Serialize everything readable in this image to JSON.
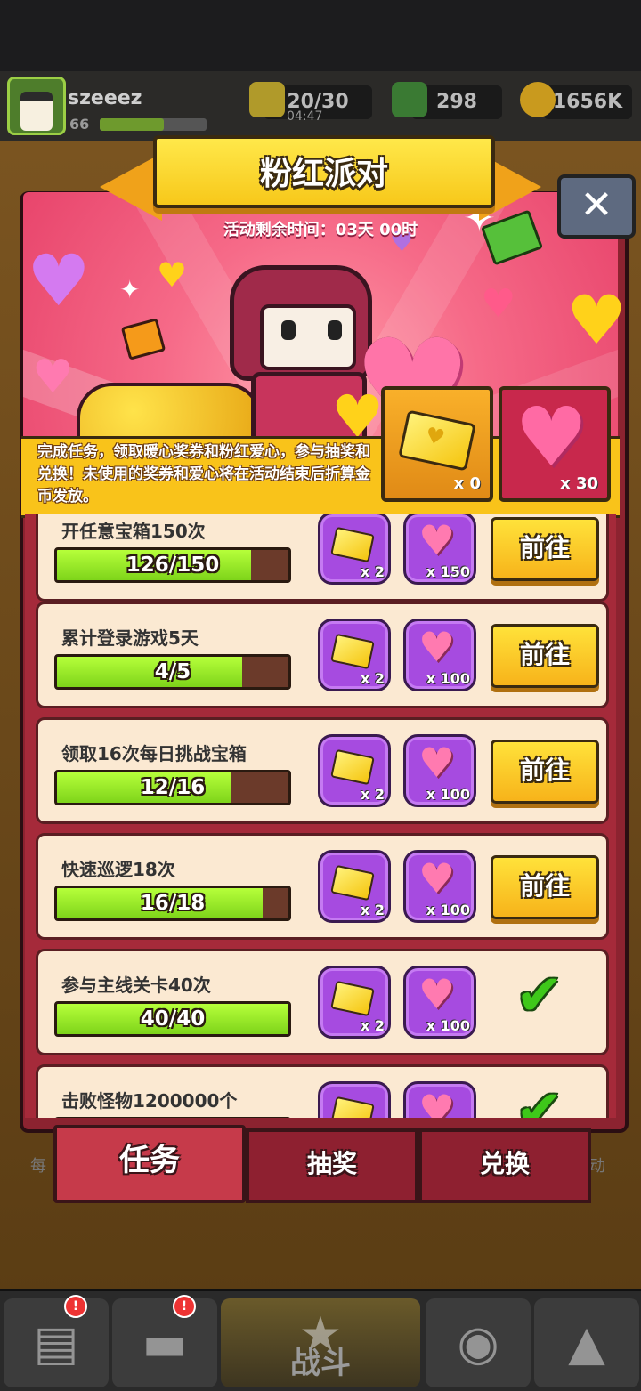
{
  "topbar": {
    "username": "szeeez",
    "level": "66",
    "energy": "20/30",
    "energy_timer": "04:47",
    "gems": "298",
    "coins": "1656K"
  },
  "event": {
    "title": "粉红派对",
    "timer": "活动剩余时间：03天 00时",
    "description": "完成任务，领取暖心奖券和粉红爱心，参与抽奖和兑换！未使用的奖券和爱心将在活动结束后折算金币发放。",
    "ticket_count": "x 0",
    "heart_count": "x 30",
    "close_symbol": "✕"
  },
  "tasks": [
    {
      "name": "开任意宝箱150次",
      "progress_text": "126/150",
      "progress": 0.84,
      "ticket_reward": "x 2",
      "heart_reward": "x 150",
      "action": "前往",
      "done": false
    },
    {
      "name": "累计登录游戏5天",
      "progress_text": "4/5",
      "progress": 0.8,
      "ticket_reward": "x 2",
      "heart_reward": "x 100",
      "action": "前往",
      "done": false
    },
    {
      "name": "领取16次每日挑战宝箱",
      "progress_text": "12/16",
      "progress": 0.75,
      "ticket_reward": "x 2",
      "heart_reward": "x 100",
      "action": "前往",
      "done": false
    },
    {
      "name": "快速巡逻18次",
      "progress_text": "16/18",
      "progress": 0.889,
      "ticket_reward": "x 2",
      "heart_reward": "x 100",
      "action": "前往",
      "done": false
    },
    {
      "name": "参与主线关卡40次",
      "progress_text": "40/40",
      "progress": 1.0,
      "ticket_reward": "x 2",
      "heart_reward": "x 100",
      "action": "",
      "done": true
    },
    {
      "name": "击败怪物1200000个",
      "progress_text": "",
      "progress": 1.0,
      "ticket_reward": "",
      "heart_reward": "",
      "action": "",
      "done": true
    }
  ],
  "tabs": {
    "tasks": "任务",
    "lottery": "抽奖",
    "exchange": "兑换"
  },
  "side_labels": {
    "left": "每",
    "right": "动"
  },
  "bottom_nav": {
    "battle": "战斗"
  },
  "colors": {
    "accent_yellow": "#f9c31a",
    "dialog_red": "#8c2330",
    "progress_green": "#7ed41a",
    "reward_purple": "#a64be0"
  },
  "icons": [
    "energy-icon",
    "gem-icon",
    "coin-icon",
    "close-icon",
    "ticket-icon",
    "heart-icon",
    "check-icon",
    "shop-icon",
    "gun-icon",
    "battle-icon",
    "globe-icon",
    "upgrade-icon"
  ]
}
